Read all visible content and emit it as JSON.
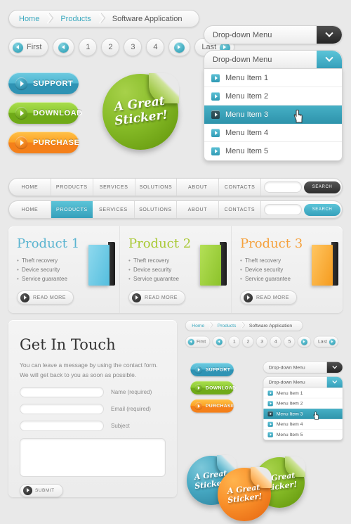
{
  "breadcrumb": {
    "items": [
      "Home",
      "Products",
      "Software Application"
    ]
  },
  "pagination": {
    "first_label": "First",
    "last_label": "Last",
    "pages": [
      "1",
      "2",
      "3",
      "4"
    ],
    "prev_icon": "arrow-left-icon",
    "next_icon": "arrow-right-icon"
  },
  "mini_pagination": {
    "pages": [
      "1",
      "2",
      "3",
      "4",
      "5"
    ]
  },
  "buttons": [
    {
      "label": "SUPPORT",
      "color": "#4fb6d2",
      "icon": "arrow-right-icon"
    },
    {
      "label": "DOWNLOAD",
      "color": "#8ecb33",
      "icon": "arrow-right-icon"
    },
    {
      "label": "PURCHASE",
      "color": "#fca324",
      "icon": "arrow-right-icon"
    }
  ],
  "sticker": {
    "line1": "A Great",
    "line2": "Sticker!"
  },
  "stickers_group": [
    {
      "color": "#46a8c2",
      "line1": "A Great",
      "line2": "Sticker!"
    },
    {
      "color": "#f9902a",
      "line1": "A Great",
      "line2": "Sticker!"
    },
    {
      "color": "#86bb27",
      "line1": "A Great",
      "line2": "Sticker!"
    }
  ],
  "nav": {
    "items": [
      "HOME",
      "PRODUCTS",
      "SERVICES",
      "SOLUTIONS",
      "ABOUT",
      "CONTACTS"
    ],
    "search_label": "SEARCH",
    "search_value": "",
    "active_item": "PRODUCTS"
  },
  "dropdown": {
    "label": "Drop-down Menu",
    "chevron_icon": "chevron-down-icon",
    "items": [
      "Menu Item 1",
      "Menu Item 2",
      "Menu Item 3",
      "Menu Item 4",
      "Menu Item 5"
    ],
    "selected": "Menu Item 3"
  },
  "products": [
    {
      "title": "Product 1",
      "features": [
        "Theft recovery",
        "Device security",
        "Service guarantee"
      ],
      "cta": "READ MORE",
      "color": "#54bede"
    },
    {
      "title": "Product 2",
      "features": [
        "Theft recovery",
        "Device security",
        "Service guarantee"
      ],
      "cta": "READ MORE",
      "color": "#8cc22a"
    },
    {
      "title": "Product 3",
      "features": [
        "Theft recovery",
        "Device security",
        "Service guarantee"
      ],
      "cta": "READ MORE",
      "color": "#f59b1e"
    }
  ],
  "contact": {
    "heading": "Get In Touch",
    "description": "You can leave a message by using the contact form. We will get back to you as soon as possible.",
    "fields": [
      {
        "label": "Name (required)",
        "value": ""
      },
      {
        "label": "Email (required)",
        "value": ""
      },
      {
        "label": "Subject",
        "value": ""
      }
    ],
    "message_value": "",
    "submit_label": "SUBMIT"
  }
}
